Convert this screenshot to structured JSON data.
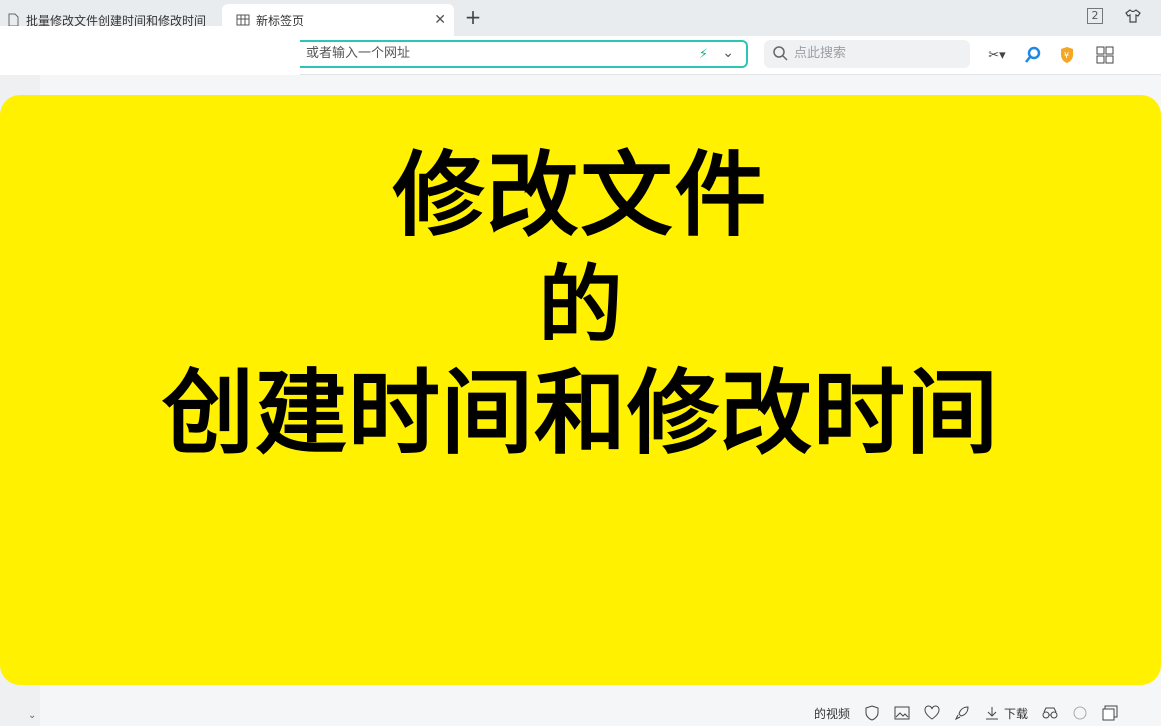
{
  "tabs": [
    {
      "title": "批量修改文件创建时间和修改时间",
      "active": false
    },
    {
      "title": "新标签页",
      "active": true
    }
  ],
  "window": {
    "tab_count_badge": "2"
  },
  "address": {
    "placeholder": "或者输入一个网址"
  },
  "search": {
    "placeholder": "点此搜索"
  },
  "overlay": {
    "line1": "修改文件",
    "line2": "的",
    "line3": "创建时间和修改时间",
    "background": "#fff100"
  },
  "statusbar": {
    "video_label": "的视频",
    "download_label": "下载"
  },
  "colors": {
    "accent": "#2cc6b5"
  }
}
